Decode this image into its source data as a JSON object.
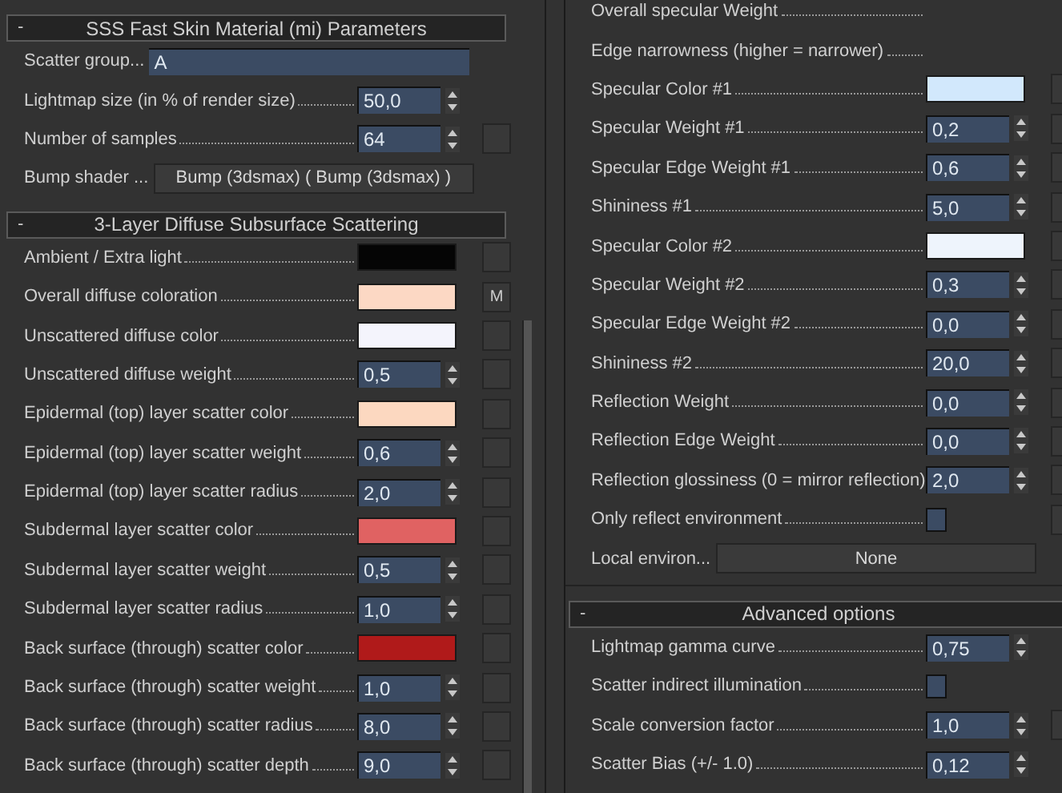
{
  "left": {
    "sections": [
      {
        "title": "SSS Fast Skin Material (mi) Parameters",
        "collapse": "-",
        "rows": [
          {
            "kind": "text",
            "label": "Scatter group...",
            "value": "A",
            "map_button": false
          },
          {
            "kind": "spinner",
            "label": "Lightmap size (in % of render size)",
            "value": "50,0",
            "map_button": false
          },
          {
            "kind": "spinner",
            "label": "Number of samples",
            "value": "64",
            "map_button": true
          },
          {
            "kind": "button",
            "label": "Bump shader ...",
            "value": "Bump (3dsmax)  ( Bump (3dsmax) )",
            "map_button": false
          }
        ]
      },
      {
        "title": "3-Layer Diffuse Subsurface Scattering",
        "collapse": "-",
        "rows": [
          {
            "kind": "color",
            "label": "Ambient / Extra light",
            "color": "#050505",
            "map_button": true
          },
          {
            "kind": "color",
            "label": "Overall diffuse coloration",
            "color": "#fcd8c4",
            "map_button": true,
            "map_label": "M"
          },
          {
            "kind": "color",
            "label": "Unscattered diffuse color",
            "color": "#f4f4fc",
            "map_button": true
          },
          {
            "kind": "spinner",
            "label": "Unscattered diffuse weight",
            "value": "0,5",
            "map_button": true
          },
          {
            "kind": "color",
            "label": "Epidermal (top) layer scatter color",
            "color": "#fcd8c0",
            "map_button": true
          },
          {
            "kind": "spinner",
            "label": "Epidermal (top) layer scatter weight",
            "value": "0,6",
            "map_button": true
          },
          {
            "kind": "spinner",
            "label": "Epidermal (top) layer scatter radius",
            "value": "2,0",
            "map_button": true
          },
          {
            "kind": "color",
            "label": "Subdermal layer scatter color",
            "color": "#e06262",
            "map_button": true
          },
          {
            "kind": "spinner",
            "label": "Subdermal layer scatter weight",
            "value": "0,5",
            "map_button": true
          },
          {
            "kind": "spinner",
            "label": "Subdermal layer scatter radius",
            "value": "1,0",
            "map_button": true
          },
          {
            "kind": "color",
            "label": "Back surface (through) scatter color",
            "color": "#b01a1a",
            "map_button": true
          },
          {
            "kind": "spinner",
            "label": "Back surface (through) scatter weight",
            "value": "1,0",
            "map_button": true
          },
          {
            "kind": "spinner",
            "label": "Back surface (through) scatter radius",
            "value": "8,0",
            "map_button": true
          },
          {
            "kind": "spinner",
            "label": "Back surface (through) scatter depth",
            "value": "9,0",
            "map_button": true
          }
        ]
      }
    ]
  },
  "right": {
    "rows": [
      {
        "kind": "label",
        "label": "Overall specular Weight",
        "map_button": false
      },
      {
        "kind": "label",
        "label": "Edge narrowness (higher = narrower)",
        "map_button": false
      },
      {
        "kind": "color",
        "label": "Specular Color #1",
        "color": "#d2e8fc",
        "map_button": true
      },
      {
        "kind": "spinner",
        "label": "Specular Weight #1",
        "value": "0,2",
        "map_button": true
      },
      {
        "kind": "spinner",
        "label": "Specular Edge Weight #1",
        "value": "0,6",
        "map_button": true
      },
      {
        "kind": "spinner",
        "label": "Shininess #1",
        "value": "5,0",
        "map_button": true
      },
      {
        "kind": "color",
        "label": "Specular Color #2",
        "color": "#eef4fc",
        "map_button": true
      },
      {
        "kind": "spinner",
        "label": "Specular Weight #2",
        "value": "0,3",
        "map_button": true
      },
      {
        "kind": "spinner",
        "label": "Specular Edge Weight #2",
        "value": "0,0",
        "map_button": true
      },
      {
        "kind": "spinner",
        "label": "Shininess #2",
        "value": "20,0",
        "map_button": true
      },
      {
        "kind": "spinner",
        "label": "Reflection Weight",
        "value": "0,0",
        "map_button": true
      },
      {
        "kind": "spinner",
        "label": "Reflection Edge Weight",
        "value": "0,0",
        "map_button": true
      },
      {
        "kind": "spinner",
        "label": "Reflection glossiness (0 = mirror reflection)",
        "value": "2,0",
        "map_button": true
      },
      {
        "kind": "checkbox",
        "label": "Only reflect environment",
        "checked": false,
        "map_button": true
      },
      {
        "kind": "button",
        "label": "Local environ...",
        "value": "None",
        "map_button": false
      }
    ],
    "sections": [
      {
        "title": "Advanced options",
        "collapse": "-",
        "rows": [
          {
            "kind": "spinner",
            "label": "Lightmap gamma curve",
            "value": "0,75",
            "map_button": false
          },
          {
            "kind": "checkbox",
            "label": "Scatter indirect illumination",
            "checked": false,
            "map_button": false
          },
          {
            "kind": "spinner",
            "label": "Scale conversion factor",
            "value": "1,0",
            "map_button": true
          },
          {
            "kind": "spinner",
            "label": "Scatter Bias (+/- 1.0)",
            "value": "0,12",
            "map_button": false
          }
        ]
      }
    ]
  }
}
